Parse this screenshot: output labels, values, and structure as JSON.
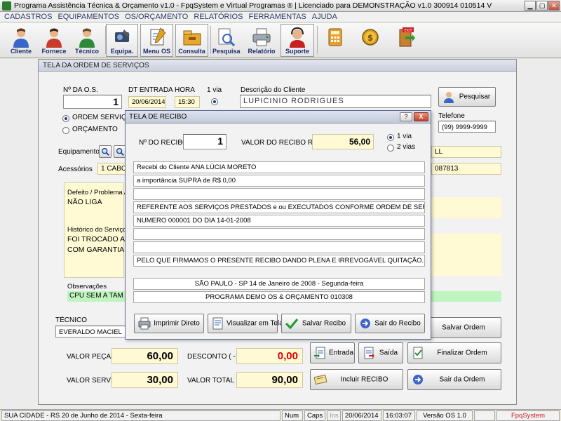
{
  "window": {
    "title": "Programa Assistência Técnica & Orçamento v1.0 - FpqSystem e Virtual Programas ® | Licenciado para  DEMONSTRAÇÃO v1.0 300914 010514 V"
  },
  "menu": [
    "CADASTROS",
    "EQUIPAMENTOS",
    "OS/ORÇAMENTO",
    "RELATÓRIOS",
    "FERRAMENTAS",
    "AJUDA"
  ],
  "toolbar": {
    "cliente": "Cliente",
    "fornece": "Fornece",
    "tecnico": "Técnico",
    "equipa": "Equipa.",
    "menu_os": "Menu OS",
    "consulta": "Consulta",
    "pesquisa": "Pesquisa",
    "relatorio": "Relatório",
    "suporte": "Suporte",
    "exit_sign": "EXIT"
  },
  "os_form": {
    "title": "TELA DA ORDEM DE SERVIÇOS",
    "num_os_label": "Nº DA O.S.",
    "num_os_value": "1",
    "dt_entrada_label": "DT ENTRADA",
    "dt_entrada_value": "20/06/2014",
    "hora_label": "HORA",
    "hora_value": "15:30",
    "via_label": "1 via",
    "ordem_servico_label": "ORDEM SERVIÇO",
    "orcamento_label": "ORÇAMENTO",
    "desc_cliente_label": "Descrição do Cliente",
    "desc_cliente_value": "LUPICINIO RODRIGUES",
    "pesquisar_button": "Pesquisar",
    "telefone_label": "Telefone",
    "telefone_value": "(99) 9999-9999",
    "equipamento_label": "Equipamento",
    "equip_tail": "LL",
    "acessorios_label": "Acessórios",
    "acessorios_value": "1 CABO",
    "acess_tail": "087813",
    "defeito_label": "Defeito / Problema Ap",
    "defeito_value": "NÃO LIGA",
    "historico_label": "Histórico do Serviço E",
    "historico_line1": "FOI TROCADO A",
    "historico_line2": "COM GARANTIA",
    "observacoes_label": "Observações",
    "observacoes_value": "CPU SEM A TAM",
    "tecnico_label": "TÉCNICO",
    "tecnico_value": "EVERALDO MACIEL",
    "valor_pecas_label": "VALOR PEÇAS",
    "valor_pecas_value": "60,00",
    "desconto_label": "DESCONTO ( - )",
    "desconto_value": "0,00",
    "valor_servicos_label": "VALOR SERVIÇOS",
    "valor_servicos_value": "30,00",
    "valor_total_label": "VALOR TOTAL",
    "valor_total_value": "90,00",
    "salvar_ordem": "Salvar Ordem",
    "entrada": "Entrada",
    "saida": "Saída",
    "finalizar_ordem": "Finalizar Ordem",
    "incluir_recibo": "Incluir RECIBO",
    "sair_da_ordem": "Sair da Ordem"
  },
  "recibo": {
    "title": "TELA DE RECIBO",
    "help": "?",
    "close": "X",
    "num_label": "Nº DO RECIBO",
    "num_value": "1",
    "valor_label": "VALOR DO RECIBO R$",
    "valor_value": "56,00",
    "via1": "1 via",
    "via2": "2 vias",
    "lines": [
      "Recebi do Cliente  ANA LÚCIA MORETO",
      "a importância SUPRA de R$          0,00",
      "",
      "REFERENTE AOS SERVIÇOS PRESTADOS e ou EXECUTADOS CONFORME ORDEM DE SERVIÇO",
      "NUMERO 000001 DO DIA 14-01-2008",
      "",
      "",
      "PELO QUE FIRMAMOS O PRESENTE RECIBO DANDO PLENA E IRREVOGÁVEL QUITAÇÃO."
    ],
    "local_data": "SÃO PAULO - SP 14 de Janeiro de 2008 - Segunda-feira",
    "programa": "PROGRAMA DEMO OS & ORÇAMENTO 010308",
    "imprimir": "Imprimir Direto",
    "visualizar": "Visualizar em Tela",
    "salvar": "Salvar Recibo",
    "sair": "Sair do Recibo"
  },
  "statusbar": {
    "cidade": "SUA CIDADE - RS 20 de Junho de 2014 - Sexta-feira",
    "num": "Num",
    "caps": "Caps",
    "ins": "Ins",
    "data": "20/06/2014",
    "hora": "16:03:07",
    "versao": "Versão OS 1.0",
    "brand": "FpqSystem"
  },
  "colors": {
    "accent_blue": "#1C2C6C",
    "yellow_field": "#FFF9D4",
    "green_field": "#BFF5BF",
    "red_value": "#E00000"
  }
}
